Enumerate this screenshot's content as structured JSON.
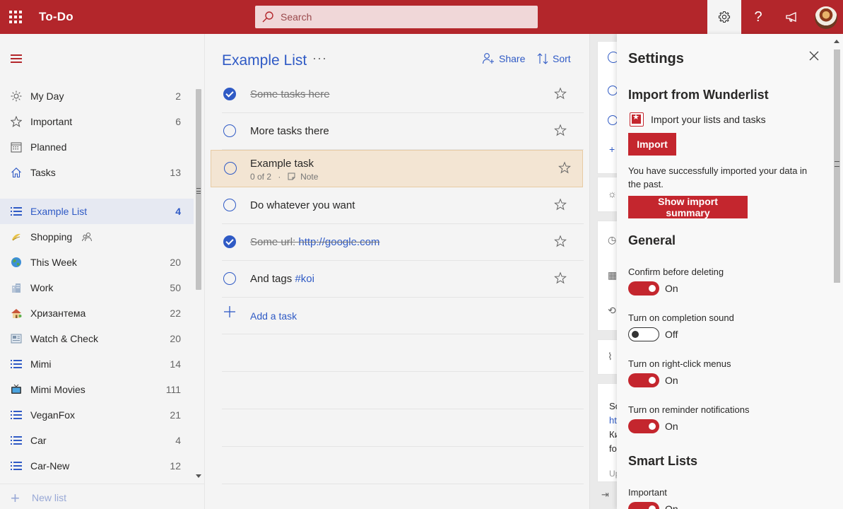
{
  "app": {
    "title": "To-Do"
  },
  "search": {
    "placeholder": "Search"
  },
  "topbar": {
    "help_glyph": "?"
  },
  "sidebar": {
    "smart_lists": [
      {
        "label": "My Day",
        "count": "2",
        "icon": "sun-icon"
      },
      {
        "label": "Important",
        "count": "6",
        "icon": "star-icon"
      },
      {
        "label": "Planned",
        "count": "",
        "icon": "calendar-icon"
      },
      {
        "label": "Tasks",
        "count": "13",
        "icon": "home-icon"
      }
    ],
    "lists": [
      {
        "label": "Example List",
        "count": "4",
        "icon": "list-icon",
        "selected": true
      },
      {
        "label": "Shopping",
        "count": "",
        "icon": "shopping-emoji-icon",
        "shared": true
      },
      {
        "label": "This Week",
        "count": "20",
        "icon": "globe-emoji-icon"
      },
      {
        "label": "Work",
        "count": "50",
        "icon": "office-emoji-icon"
      },
      {
        "label": "Хризантема",
        "count": "22",
        "icon": "house-emoji-icon"
      },
      {
        "label": "Watch & Check",
        "count": "20",
        "icon": "newspaper-emoji-icon"
      },
      {
        "label": "Mimi",
        "count": "14",
        "icon": "list-icon"
      },
      {
        "label": "Mimi Movies",
        "count": "111",
        "icon": "tv-emoji-icon"
      },
      {
        "label": "VeganFox",
        "count": "21",
        "icon": "list-icon"
      },
      {
        "label": "Car",
        "count": "4",
        "icon": "list-icon"
      },
      {
        "label": "Car-New",
        "count": "12",
        "icon": "list-icon"
      }
    ],
    "new_list_label": "New list"
  },
  "main": {
    "title": "Example List",
    "more_glyph": "···",
    "share_label": "Share",
    "sort_label": "Sort",
    "tasks": [
      {
        "title": "Some tasks here",
        "done": true
      },
      {
        "title": "More tasks there",
        "done": false
      },
      {
        "title": "Example task",
        "done": false,
        "steps": "0 of 2",
        "separator": "·",
        "note": "Note"
      },
      {
        "title": "Do whatever you want",
        "done": false
      },
      {
        "title_prefix": "Some url: ",
        "link": "http://google.com",
        "done": true
      },
      {
        "title_prefix": "And tags ",
        "tag": "#koi",
        "done": false
      }
    ],
    "add_task_label": "Add a task"
  },
  "detail": {
    "snippet_lines": [
      "So",
      "htt",
      "Ки",
      "fo",
      "Up"
    ]
  },
  "settings": {
    "title": "Settings",
    "import_section": {
      "heading": "Import from Wunderlist",
      "import_desc": "Import your lists and tasks",
      "import_button": "Import",
      "success_text": "You have successfully imported your data in the past.",
      "summary_button": "Show import summary"
    },
    "general": {
      "heading": "General",
      "items": [
        {
          "label": "Confirm before deleting",
          "state": "On"
        },
        {
          "label": "Turn on completion sound",
          "state": "Off"
        },
        {
          "label": "Turn on right-click menus",
          "state": "On"
        },
        {
          "label": "Turn on reminder notifications",
          "state": "On"
        }
      ]
    },
    "smart_lists": {
      "heading": "Smart Lists",
      "items": [
        {
          "label": "Important",
          "state": "On"
        }
      ]
    }
  },
  "colors": {
    "brand": "#b3262b",
    "accent": "#2f5ac5",
    "toggle_on": "#c4262e"
  }
}
